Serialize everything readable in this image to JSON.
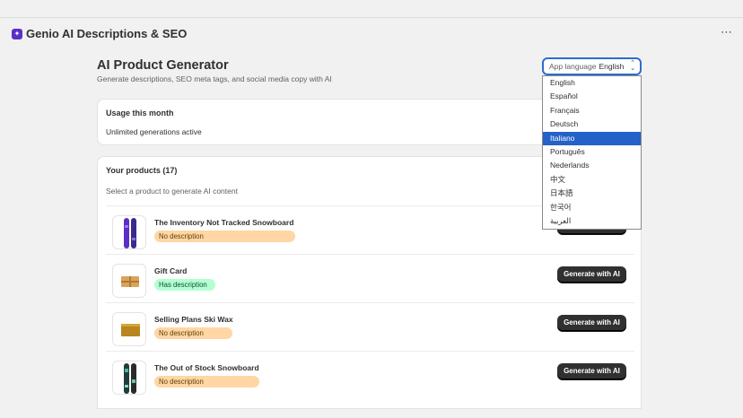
{
  "app": {
    "title": "Genio AI Descriptions & SEO",
    "more_label": "⋯"
  },
  "page": {
    "title": "AI Product Generator",
    "subtitle": "Generate descriptions, SEO meta tags, and social media copy with AI"
  },
  "language_select": {
    "label": "App language",
    "value": "English",
    "options": [
      "English",
      "Español",
      "Français",
      "Deutsch",
      "Italiano",
      "Português",
      "Nederlands",
      "中文",
      "日本語",
      "한국어",
      "العربية"
    ],
    "highlighted": "Italiano"
  },
  "usage": {
    "title": "Usage this month",
    "text": "Unlimited generations active"
  },
  "products": {
    "title": "Your products (17)",
    "subtitle": "Select a product to generate AI content",
    "button_label": "Generate with AI",
    "items": [
      {
        "name": "The Inventory Not Tracked Snowboard",
        "status": "No description",
        "status_type": "no",
        "thumb": "snowboard-purple"
      },
      {
        "name": "Gift Card",
        "status": "Has description",
        "status_type": "has",
        "thumb": "gift-card"
      },
      {
        "name": "Selling Plans Ski Wax",
        "status": "No description",
        "status_type": "no",
        "thumb": "ski-wax"
      },
      {
        "name": "The Out of Stock Snowboard",
        "status": "No description",
        "status_type": "no",
        "thumb": "snowboard-teal"
      }
    ]
  },
  "colors": {
    "primary_button": "#303030",
    "focus_ring": "#2c6ecb",
    "badge_no": "#ffd6a4",
    "badge_has": "#b4fed2",
    "highlight": "#2461c8"
  }
}
